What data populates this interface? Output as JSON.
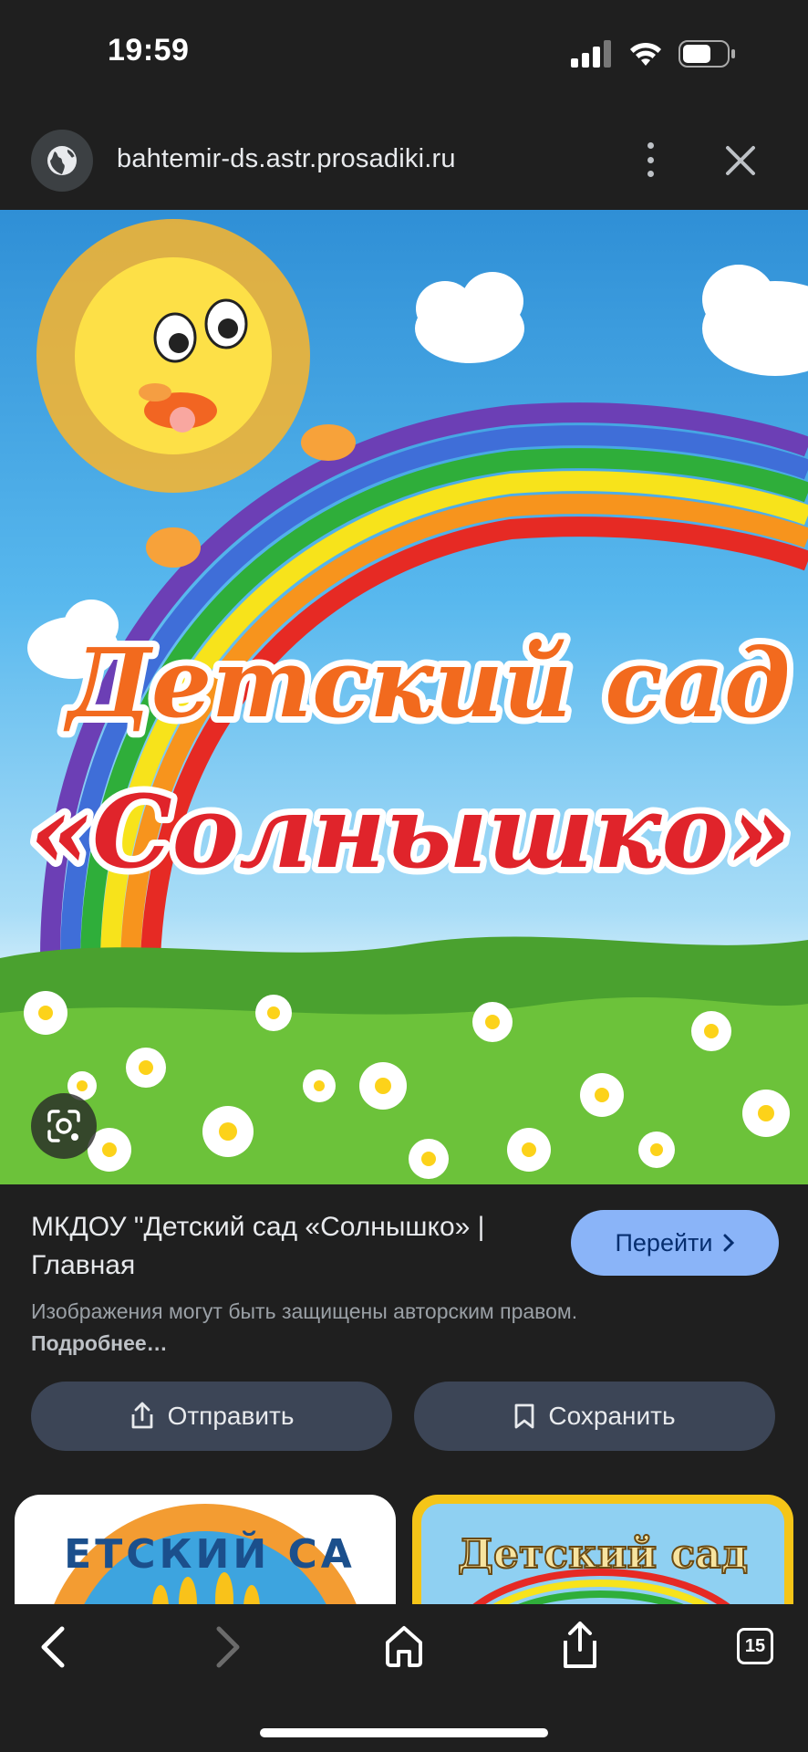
{
  "status": {
    "time": "19:59"
  },
  "browser": {
    "url": "bahtemir-ds.astr.prosadiki.ru",
    "tabs_count": "15"
  },
  "hero": {
    "line1": "Детский сад",
    "line2": "«Солнышко»"
  },
  "result": {
    "title": "МКДОУ \"Детский сад «Солнышко» | Главная",
    "goto_label": "Перейти",
    "copyright_text": "Изображения могут быть защищены авторским правом.",
    "more_label": "Подробнее…",
    "share_label": "Отправить",
    "save_label": "Сохранить"
  },
  "thumbs": {
    "left_text": "ЕТСКИЙ СА",
    "right_text": "Детский сад"
  },
  "colors": {
    "background": "#1f1f1f",
    "accent": "#8ab4f8",
    "pill": "#3c4556"
  }
}
